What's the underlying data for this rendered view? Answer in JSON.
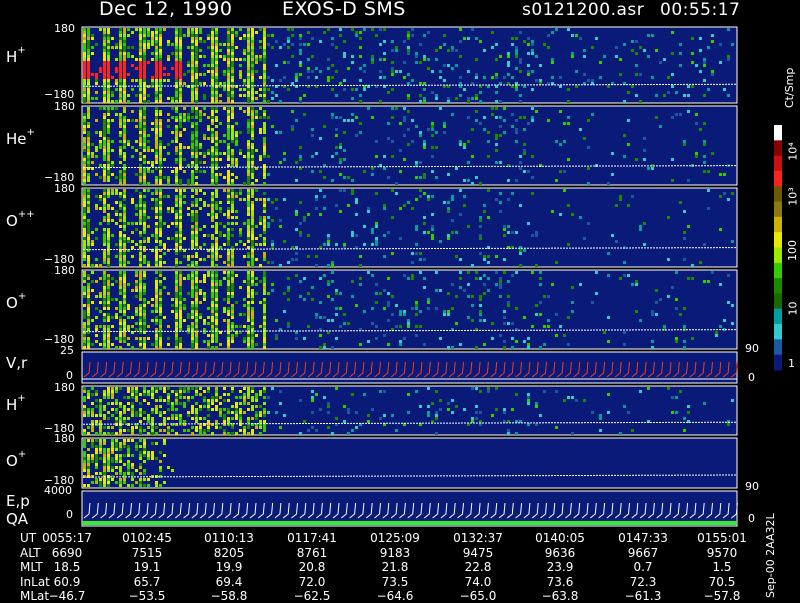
{
  "header": {
    "date": "Dec 12, 1990",
    "instrument": "EXOS-D SMS",
    "file": "s0121200.asr",
    "time": "00:55:17"
  },
  "colors": {
    "background": "#000000",
    "panel": "#0a1a78",
    "sample_line": "#ffffff",
    "vr_trace": "#ff3a1a",
    "qa_bar": "#33ee33"
  },
  "panels": [
    {
      "label": "H",
      "charge": "+",
      "ymax": "180",
      "ymin": "−180"
    },
    {
      "label": "He",
      "charge": "+",
      "ymax": "180",
      "ymin": "−180"
    },
    {
      "label": "O",
      "charge": "++",
      "ymax": "180",
      "ymin": "−180"
    },
    {
      "label": "O",
      "charge": "+",
      "ymax": "180",
      "ymin": "−180"
    },
    {
      "label": "V,r",
      "charge": "",
      "ymax": "25",
      "ymin": "0",
      "right": "90",
      "right_min": "0"
    },
    {
      "label": "H",
      "charge": "+",
      "ymax": "180",
      "ymin": "−180"
    },
    {
      "label": "O",
      "charge": "+",
      "ymax": "180",
      "ymin": "−180"
    },
    {
      "label": "E,p",
      "label2": "QA",
      "charge": "",
      "ymax": "4000",
      "ymin": "0",
      "right": "90",
      "right_min": "0"
    }
  ],
  "colorbar": {
    "unit": "Ct/Smp",
    "ticks": [
      "10⁴",
      "10³",
      "100",
      "10",
      "1"
    ],
    "stops": [
      "#ffffff",
      "#8a0000",
      "#cc1111",
      "#ff2222",
      "#6b5a00",
      "#8c7a10",
      "#c8b400",
      "#e8e800",
      "#9ee800",
      "#33cc00",
      "#1a8a00",
      "#1a6a00",
      "#00a0a0",
      "#33cccc",
      "#1a5aa0",
      "#0a1a78"
    ]
  },
  "footer": {
    "rows": [
      {
        "name": "UT",
        "values": [
          "0055:17",
          "0102:45",
          "0110:13",
          "0117:41",
          "0125:09",
          "0132:37",
          "0140:05",
          "0147:33",
          "0155:01"
        ]
      },
      {
        "name": "ALT",
        "values": [
          "6690",
          "7515",
          "8205",
          "8761",
          "9183",
          "9475",
          "9636",
          "9667",
          "9570"
        ]
      },
      {
        "name": "MLT",
        "values": [
          "18.5",
          "19.1",
          "19.9",
          "20.8",
          "21.8",
          "22.8",
          "23.9",
          "0.7",
          "1.5"
        ]
      },
      {
        "name": "InLat",
        "values": [
          "60.9",
          "65.7",
          "69.4",
          "72.0",
          "73.5",
          "74.0",
          "73.6",
          "72.3",
          "70.5"
        ]
      },
      {
        "name": "MLat",
        "values": [
          "−46.7",
          "−53.5",
          "−58.8",
          "−62.5",
          "−64.6",
          "−65.0",
          "−63.8",
          "−61.3",
          "−57.8"
        ]
      }
    ],
    "side_text": "Sep-00 2AA32L"
  },
  "chart_data": {
    "type": "heatmap",
    "title": "Dec 12, 1990   EXOS-D SMS",
    "x": [
      "0055:17",
      "0102:45",
      "0110:13",
      "0117:41",
      "0125:09",
      "0132:37",
      "0140:05",
      "0147:33",
      "0155:01"
    ],
    "colorbar_unit": "Ct/Smp",
    "colorbar_scale": "log",
    "colorbar_range": [
      1,
      10000
    ],
    "series": [
      {
        "name": "H+",
        "yrange": [
          -180,
          180
        ]
      },
      {
        "name": "He+",
        "yrange": [
          -180,
          180
        ]
      },
      {
        "name": "O++",
        "yrange": [
          -180,
          180
        ]
      },
      {
        "name": "O+",
        "yrange": [
          -180,
          180
        ]
      },
      {
        "name": "V,r",
        "yrange": [
          0,
          25
        ],
        "right_range": [
          0,
          90
        ]
      },
      {
        "name": "H+",
        "yrange": [
          -180,
          180
        ]
      },
      {
        "name": "O+",
        "yrange": [
          -180,
          180
        ]
      },
      {
        "name": "E,p",
        "yrange": [
          0,
          4000
        ],
        "right_range": [
          0,
          90
        ]
      }
    ]
  }
}
